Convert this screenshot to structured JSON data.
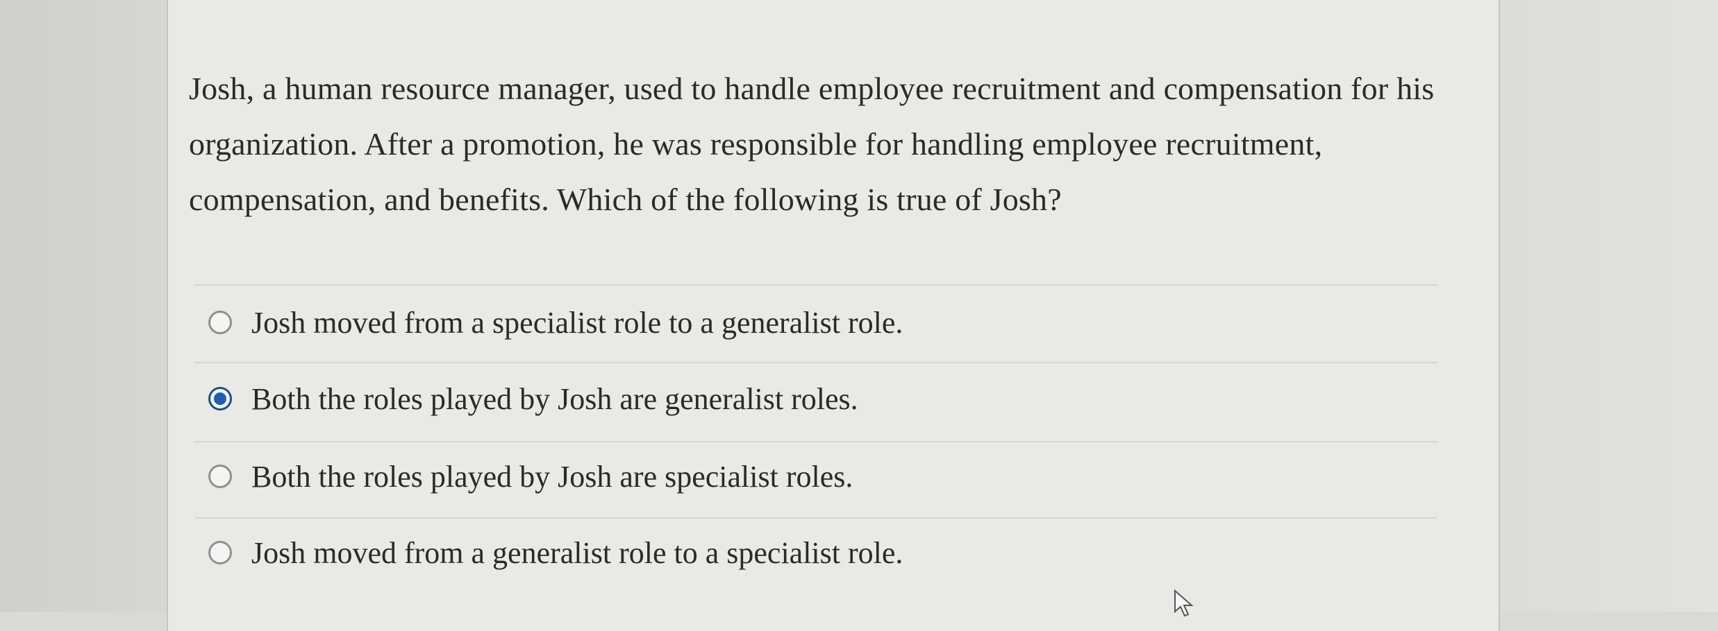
{
  "question": {
    "text": "Josh, a human resource manager, used to handle employee recruitment and compensation for his organization. After a promotion, he was responsible for handling employee recruitment, compensation, and benefits. Which of the following is true of Josh?"
  },
  "options": [
    {
      "label": "Josh moved from a specialist role to a generalist role.",
      "selected": false
    },
    {
      "label": "Both the roles played by Josh are generalist roles.",
      "selected": true
    },
    {
      "label": "Both the roles played by Josh are specialist roles.",
      "selected": false
    },
    {
      "label": "Josh moved from a generalist role to a specialist role.",
      "selected": false
    }
  ],
  "colors": {
    "radio_selected": "#1f5fb0",
    "text": "#2a2a2a",
    "card_background": "#e9e9e6"
  },
  "icons": {
    "cursor": "mouse-pointer-icon"
  }
}
